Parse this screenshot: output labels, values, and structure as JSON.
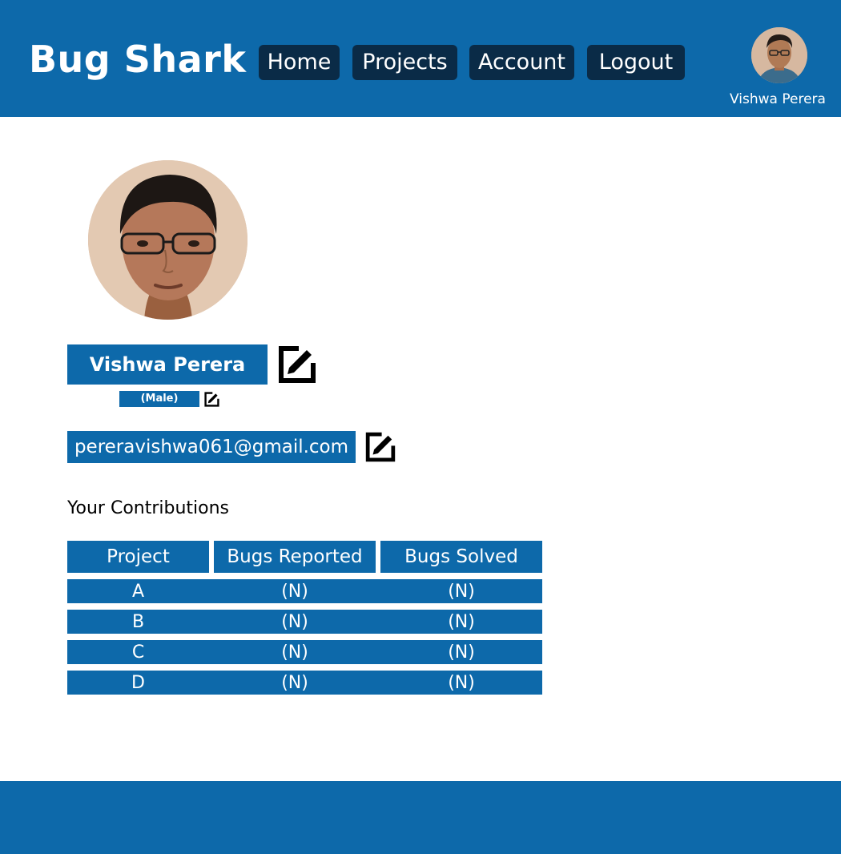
{
  "app": {
    "brand": "Bug Shark"
  },
  "nav": {
    "items": [
      "Home",
      "Projects",
      "Account",
      "Logout"
    ]
  },
  "user": {
    "name": "Vishwa Perera",
    "gender": "(Male)",
    "email": "pereravishwa061@gmail.com"
  },
  "contributions": {
    "title": "Your Contributions",
    "headers": [
      "Project",
      "Bugs Reported",
      "Bugs Solved"
    ],
    "rows": [
      [
        "A",
        "(N)",
        "(N)"
      ],
      [
        "B",
        "(N)",
        "(N)"
      ],
      [
        "C",
        "(N)",
        "(N)"
      ],
      [
        "D",
        "(N)",
        "(N)"
      ]
    ]
  },
  "colors": {
    "primary": "#0d69aa",
    "nav_button": "#0a2b47",
    "background": "#ffffff"
  },
  "icons": {
    "edit": "edit-icon",
    "avatar": "avatar"
  }
}
